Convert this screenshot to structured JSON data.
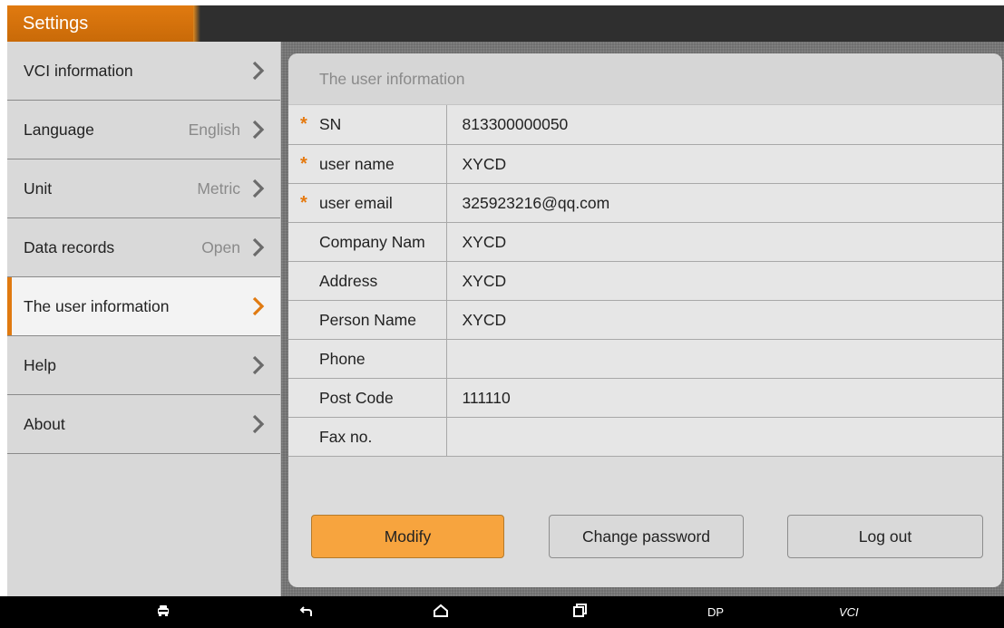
{
  "app": {
    "title": "Settings"
  },
  "sidebar": {
    "items": [
      {
        "label": "VCI information",
        "value": "",
        "active": false
      },
      {
        "label": "Language",
        "value": "English",
        "active": false
      },
      {
        "label": "Unit",
        "value": "Metric",
        "active": false
      },
      {
        "label": "Data records",
        "value": "Open",
        "active": false
      },
      {
        "label": "The user information",
        "value": "",
        "active": true
      },
      {
        "label": "Help",
        "value": "",
        "active": false
      },
      {
        "label": "About",
        "value": "",
        "active": false
      }
    ]
  },
  "panel": {
    "title": "The user information",
    "required_marker": "*",
    "rows": [
      {
        "label": "SN",
        "value": "813300000050",
        "required": true
      },
      {
        "label": "user name",
        "value": "XYCD",
        "required": true
      },
      {
        "label": "user email",
        "value": "325923216@qq.com",
        "required": true
      },
      {
        "label": "Company Nam",
        "value": "XYCD",
        "required": false
      },
      {
        "label": "Address",
        "value": "XYCD",
        "required": false
      },
      {
        "label": "Person Name",
        "value": "XYCD",
        "required": false
      },
      {
        "label": "Phone",
        "value": "",
        "required": false
      },
      {
        "label": "Post Code",
        "value": "111110",
        "required": false
      },
      {
        "label": "Fax no.",
        "value": "",
        "required": false
      }
    ]
  },
  "buttons": {
    "modify": "Modify",
    "change_password": "Change password",
    "logout": "Log out"
  },
  "navbar": {
    "dp_label": "DP",
    "vci_label": "VCI"
  },
  "colors": {
    "accent": "#e07a10",
    "primary_button": "#f7a43e",
    "required_star": "#e57a10"
  },
  "icons": {
    "chevron": "chevron-right-icon",
    "required": "asterisk-icon",
    "nav": [
      "car-icon",
      "back-icon",
      "home-icon",
      "recent-apps-icon",
      "vci-connector-icon"
    ]
  }
}
